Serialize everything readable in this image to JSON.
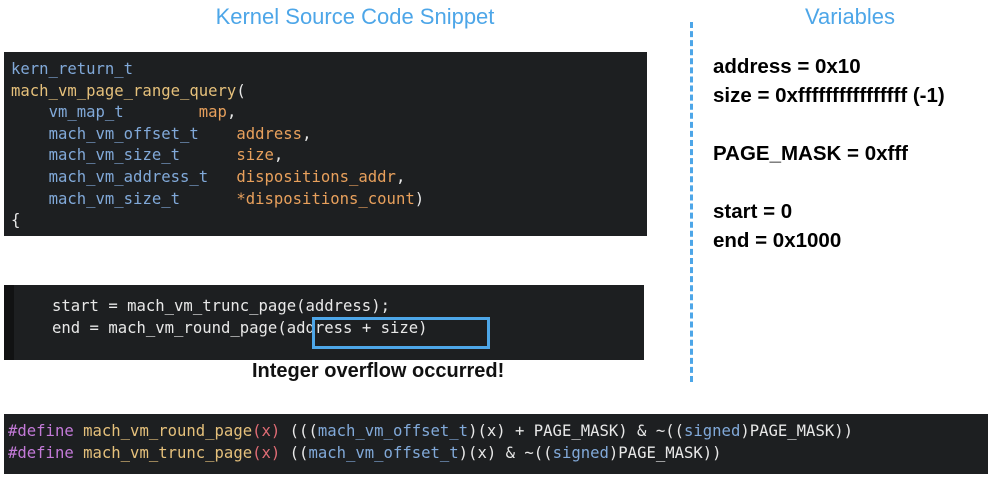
{
  "headings": {
    "left": "Kernel Source Code Snippet",
    "right": "Variables"
  },
  "code_block_1": {
    "line1": "kern_return_t",
    "line2_func": "mach_vm_page_range_query",
    "line2_paren": "(",
    "params": [
      {
        "type": "vm_map_t",
        "pad": "        ",
        "name": "map",
        "sep": ","
      },
      {
        "type": "mach_vm_offset_t",
        "pad": "    ",
        "name": "address",
        "sep": ","
      },
      {
        "type": "mach_vm_size_t",
        "pad": "      ",
        "name": "size",
        "sep": ","
      },
      {
        "type": "mach_vm_address_t",
        "pad": "   ",
        "name": "dispositions_addr",
        "sep": ","
      },
      {
        "type": "mach_vm_size_t",
        "pad": "      ",
        "name": "*dispositions_count",
        "sep": ")"
      }
    ],
    "brace": "{"
  },
  "code_block_2": {
    "line1": "start = mach_vm_trunc_page(address);",
    "line2_prefix": "end = mach_vm_round_page",
    "line2_highlight": "(address + size)"
  },
  "highlight_caption": "Integer overflow occurred!",
  "variables": [
    "address = 0x10",
    "size = 0xffffffffffffffff (-1)",
    "PAGE_MASK = 0xfff",
    "start = 0",
    "end = 0x1000"
  ],
  "code_block_3": {
    "define_kw": "#define",
    "round_name": "mach_vm_round_page",
    "round_param": "(x)",
    "round_body_1": "(((",
    "round_type": "mach_vm_offset_t",
    "round_body_2": ")(x) + PAGE_MASK) & ~((",
    "round_signed": "signed",
    "round_body_3": ")PAGE_MASK))",
    "trunc_name": "mach_vm_trunc_page",
    "trunc_param": "(x)",
    "trunc_body_1": "((",
    "trunc_type": "mach_vm_offset_t",
    "trunc_body_2": ")(x) & ~((",
    "trunc_signed": "signed",
    "trunc_body_3": ")PAGE_MASK))"
  },
  "colors": {
    "heading": "#4da6e8",
    "code_bg": "#1d1f21",
    "type": "#81a9d9",
    "func": "#e5c07b",
    "param": "#e8a05c",
    "keyword": "#c37ad8"
  }
}
